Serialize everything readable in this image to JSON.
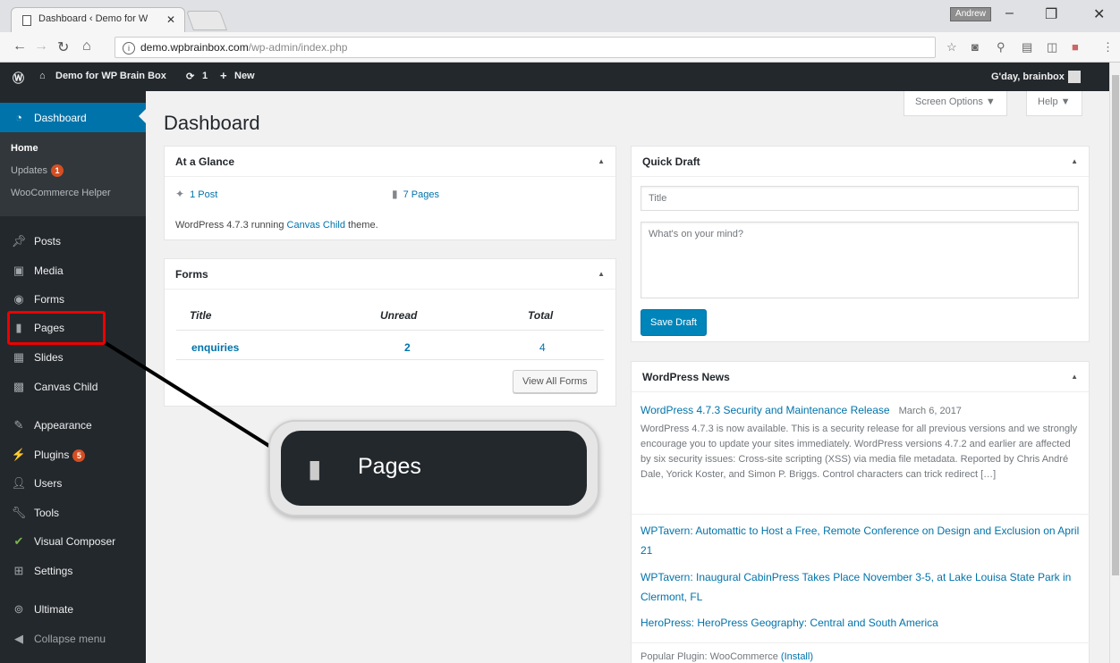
{
  "browser": {
    "tab_title": "Dashboard ‹ Demo for W",
    "tab_close": "✕",
    "profile_label": "Andrew",
    "url_host": "demo.wpbrainbox.com",
    "url_path": "/wp-admin/index.php",
    "info": "i"
  },
  "adminbar": {
    "wp_logo": "Ⓦ",
    "site_name": "Demo for WP Brain Box",
    "updates_count": "1",
    "new_label": "New",
    "greeting": "G'day, brainbox"
  },
  "sidebar": {
    "dashboard": "Dashboard",
    "sub": {
      "home": "Home",
      "updates": "Updates",
      "updates_badge": "1",
      "woocommerce_helper": "WooCommerce Helper"
    },
    "items": [
      {
        "label": "Posts",
        "icon": "pin-icon"
      },
      {
        "label": "Media",
        "icon": "media-icon"
      },
      {
        "label": "Forms",
        "icon": "forms-icon"
      },
      {
        "label": "Pages",
        "icon": "pages-icon"
      },
      {
        "label": "Slides",
        "icon": "slides-icon"
      },
      {
        "label": "Canvas Child",
        "icon": "canvas-icon"
      },
      {
        "label": "Appearance",
        "icon": "brush-icon"
      },
      {
        "label": "Plugins",
        "icon": "plugin-icon",
        "badge": "5"
      },
      {
        "label": "Users",
        "icon": "users-icon"
      },
      {
        "label": "Tools",
        "icon": "wrench-icon"
      },
      {
        "label": "Visual Composer",
        "icon": "vc-icon"
      },
      {
        "label": "Settings",
        "icon": "settings-icon"
      },
      {
        "label": "Ultimate",
        "icon": "ultimate-icon"
      },
      {
        "label": "Collapse menu",
        "icon": "collapse-icon"
      }
    ]
  },
  "main": {
    "title": "Dashboard",
    "screen_options": "Screen Options ▼",
    "help": "Help ▼"
  },
  "at_a_glance": {
    "title": "At a Glance",
    "posts": "1 Post",
    "pages": "7 Pages",
    "running_prefix": "WordPress 4.7.3 running ",
    "theme": "Canvas Child",
    "running_suffix": " theme."
  },
  "forms": {
    "title": "Forms",
    "col_title": "Title",
    "col_unread": "Unread",
    "col_total": "Total",
    "row_title": "enquiries",
    "row_unread": "2",
    "row_total": "4",
    "view_all": "View All Forms"
  },
  "quick_draft": {
    "title": "Quick Draft",
    "title_placeholder": "Title",
    "content_placeholder": "What's on your mind?",
    "save": "Save Draft"
  },
  "news": {
    "title": "WordPress News",
    "main_title": "WordPress 4.7.3 Security and Maintenance Release",
    "main_date": "March 6, 2017",
    "main_body": "WordPress 4.7.3 is now available. This is a security release for all previous versions and we strongly encourage you to update your sites immediately. WordPress versions 4.7.2 and earlier are affected by six security issues: Cross-site scripting (XSS) via media file metadata.  Reported by Chris André Dale, Yorick Koster, and Simon P. Briggs. Control characters can trick redirect […]",
    "link1": "WPTavern: Automattic to Host a Free, Remote Conference on Design and Exclusion on April 21",
    "link2": "WPTavern: Inaugural CabinPress Takes Place November 3-5, at Lake Louisa State Park in Clermont, FL",
    "link3": "HeroPress: HeroPress Geography: Central and South America",
    "popular_prefix": "Popular Plugin: WooCommerce ",
    "popular_install": "(Install)"
  },
  "callout": {
    "label": "Pages"
  },
  "colors": {
    "accent": "#0073aa",
    "sidebar_bg": "#23282d",
    "highlight": "#e00000",
    "badge": "#d54e21"
  }
}
